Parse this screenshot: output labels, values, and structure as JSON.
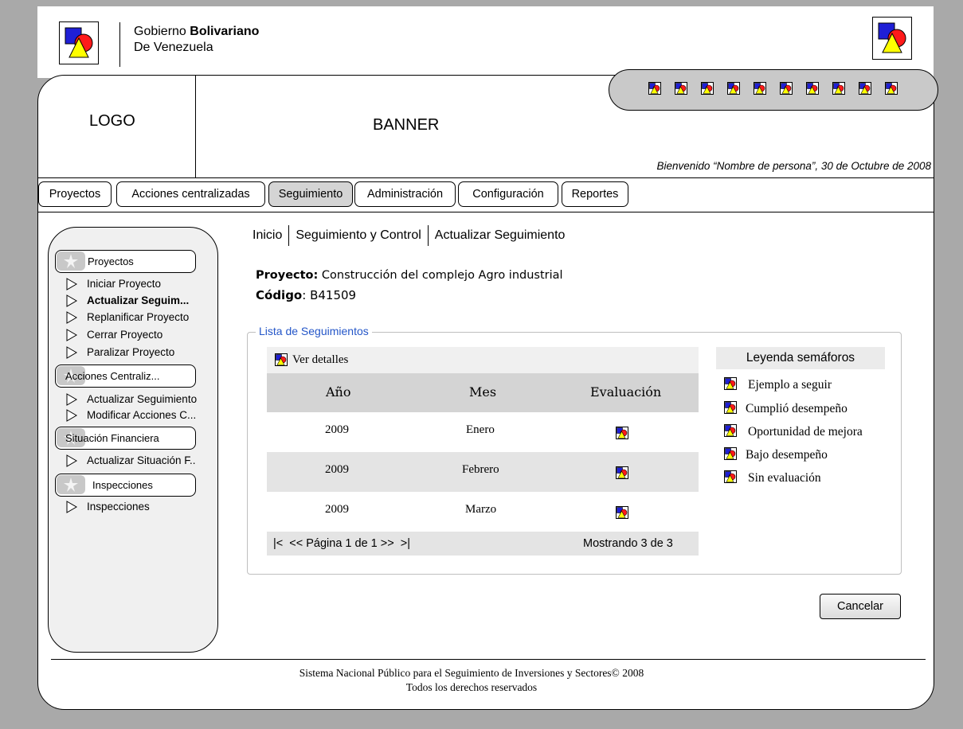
{
  "gov": {
    "line1_prefix": "Gobierno ",
    "line1_bold": "Bolivariano",
    "line2": "De Venezuela"
  },
  "header": {
    "logo": "LOGO",
    "banner": "BANNER",
    "welcome": "Bienvenido “Nombre de persona”, 30 de Octubre de 2008"
  },
  "tabs": [
    {
      "label": "Proyectos"
    },
    {
      "label": "Acciones centralizadas"
    },
    {
      "label": "Seguimiento"
    },
    {
      "label": "Administración"
    },
    {
      "label": "Configuración"
    },
    {
      "label": "Reportes"
    }
  ],
  "sidebar": {
    "sections": [
      {
        "label": "Proyectos",
        "items": [
          "Iniciar Proyecto",
          "Actualizar Seguim...",
          "Replanificar Proyecto",
          "Cerrar Proyecto",
          "Paralizar Proyecto"
        ]
      },
      {
        "label": "Acciones Centraliz...",
        "items": [
          "Actualizar Seguimiento",
          "Modificar Acciones C..."
        ]
      },
      {
        "label": "Situación Financiera",
        "items": [
          "Actualizar Situación F.."
        ]
      },
      {
        "label": "Inspecciones",
        "items": [
          "Inspecciones"
        ]
      }
    ]
  },
  "breadcrumb": [
    "Inicio",
    "Seguimiento y Control",
    "Actualizar Seguimiento"
  ],
  "project": {
    "label": "Proyecto:",
    "value": " Construcción del complejo Agro industrial",
    "code_label": "Código",
    "code_value": ": B41509"
  },
  "list": {
    "legend": "Lista de Seguimientos",
    "ver_detalles": "Ver detalles",
    "headers": [
      "Año",
      "Mes",
      "Evaluación"
    ],
    "rows": [
      {
        "year": "2009",
        "month": "Enero"
      },
      {
        "year": "2009",
        "month": "Febrero"
      },
      {
        "year": "2009",
        "month": "Marzo"
      }
    ],
    "pager": "|<  << Página 1 de 1 >>  >|",
    "showing": "Mostrando 3 de 3"
  },
  "semaphore_legend": {
    "title": "Leyenda semáforos",
    "items": [
      "Ejemplo a seguir",
      "Cumplió desempeño",
      "Oportunidad de mejora",
      "Bajo desempeño",
      "Sin evaluación"
    ]
  },
  "buttons": {
    "cancel": "Cancelar"
  },
  "footer": {
    "line1": "Sistema Nacional Público para el Seguimiento de Inversiones y Sectores© 2008",
    "line2": "Todos los derechos reservados"
  },
  "colors": {
    "icon_blue": "#1f1fd6",
    "icon_red": "#ff1a1a",
    "icon_yellow": "#ffff00",
    "legend_text": "#2456c8",
    "background": "#a9a9a9"
  }
}
